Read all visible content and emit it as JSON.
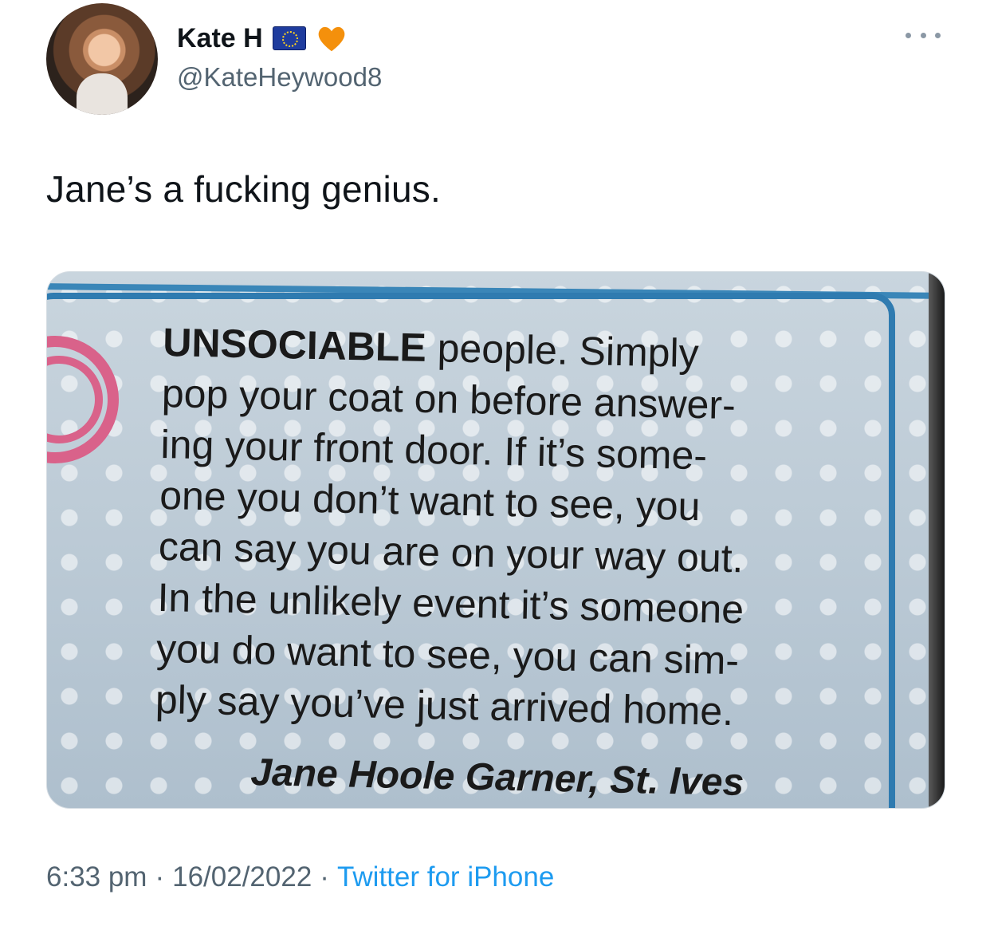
{
  "author": {
    "display_name": "Kate H",
    "handle": "@KateHeywood8",
    "badges": [
      "eu-flag-icon",
      "orange-heart-icon"
    ]
  },
  "tweet": {
    "text": "Jane’s a fucking genius."
  },
  "media": {
    "clipping_lead": "UNSOCIABLE",
    "clipping_lines": [
      "people. Simply",
      "pop your coat on before answer-",
      "ing your front door. If it’s some-",
      "one you don’t want to see, you",
      "can say you are on your way out.",
      "In the unlikely event it’s someone",
      "you do want to see, you can sim-",
      "ply say you’ve just arrived home."
    ],
    "signature": "Jane Hoole Garner, St. Ives"
  },
  "meta": {
    "time": "6:33 pm",
    "separator": "·",
    "date": "16/02/2022",
    "source": "Twitter for iPhone"
  },
  "colors": {
    "text": "#0f1419",
    "secondary": "#536471",
    "link": "#1d9bf0",
    "heart": "#f4900c",
    "clip_border": "#2f7bb0"
  }
}
